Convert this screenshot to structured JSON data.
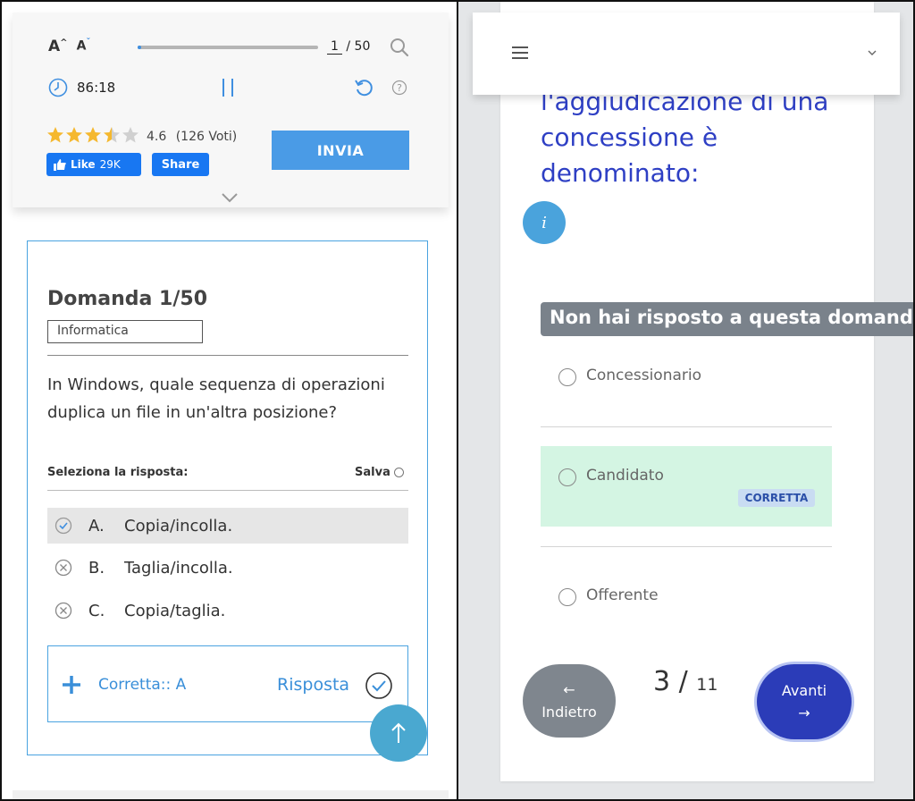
{
  "left": {
    "font_controls": {
      "increase": "A",
      "decrease": "A"
    },
    "pager": {
      "current": "1",
      "total": "/ 50",
      "progress": 0.02
    },
    "timer": "86:18",
    "rating": {
      "stars": 3.5,
      "score": "4.6",
      "votes": "(126 Voti)"
    },
    "like": {
      "label": "Like",
      "count": "29K"
    },
    "share_label": "Share",
    "submit_label": "INVIA",
    "question": {
      "title": "Domanda 1/50",
      "category": "Informatica",
      "text": "In Windows, quale sequenza di operazioni duplica un file in un'altra posizione?",
      "select_label": "Seleziona la risposta:",
      "save_label": "Salva",
      "options": [
        {
          "letter": "A.",
          "text": "Copia/incolla.",
          "state": "correct"
        },
        {
          "letter": "B.",
          "text": "Taglia/incolla.",
          "state": "wrong"
        },
        {
          "letter": "C.",
          "text": "Copia/taglia.",
          "state": "wrong"
        }
      ],
      "correct_text": "Corretta:: A",
      "answer_label": "Risposta"
    },
    "colors": {
      "accent": "#4aa3e0",
      "facebook": "#1877f2",
      "submit": "#4a9be6",
      "star": "#f5b82e"
    }
  },
  "right": {
    "question_text": "l'aggiudicazione di una concessione è denominato:",
    "info_label": "i",
    "unanswered_label": "Non hai risposto a questa domanda",
    "options": [
      {
        "text": "Concessionario",
        "correct": false
      },
      {
        "text": "Candidato",
        "correct": true
      },
      {
        "text": "Offerente",
        "correct": false
      }
    ],
    "correct_badge": "CORRETTA",
    "back": {
      "arrow": "←",
      "label": "Indietro"
    },
    "counter": {
      "current": "3 /",
      "total": "11"
    },
    "next": {
      "label": "Avanti",
      "arrow": "→"
    },
    "colors": {
      "question": "#2e3fc4",
      "next_button": "#2b3cb8",
      "correct_bg": "#d4f5e3"
    }
  }
}
